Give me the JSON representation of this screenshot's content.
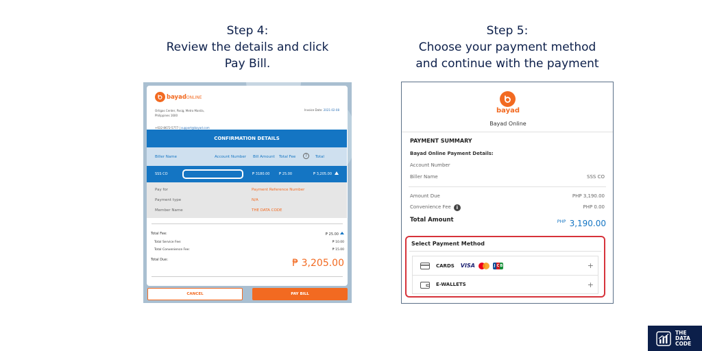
{
  "step4": {
    "line1": "Step 4:",
    "line2": "Review the details and click",
    "line3": "Pay Bill."
  },
  "step5": {
    "line1": "Step 5:",
    "line2": "Choose your payment method",
    "line3": "and continue with the payment"
  },
  "bayad_online_screen": {
    "logo_brand": "bayad",
    "logo_suffix": "ONLINE",
    "address_line1": "Ortigas Center, Pasig, Metro Manila,",
    "address_line2": "Philippines 1600",
    "invoice_label": "Invoice Date:",
    "invoice_date": "2021-02-08",
    "contact_phone": "+632-8672-5777 |",
    "contact_email": "support@bayad.com",
    "confirmation_title": "CONFIRMATION DETAILS",
    "columns": [
      "Biller Name",
      "Account Number",
      "Bill Amount",
      "Total Fee",
      "Total"
    ],
    "selected_row": {
      "biller": "SSS CO",
      "bill_amount": "₱ 3180.00",
      "total_fee": "₱ 25.00",
      "total": "₱ 3,205.00"
    },
    "details": [
      {
        "label": "Pay for",
        "value": "Payment Reference Number"
      },
      {
        "label": "Payment type",
        "value": "N/A"
      },
      {
        "label": "Member Name",
        "value": "THE DATA CODE"
      }
    ],
    "total_fee_label": "Total Fee:",
    "total_fee_value": "₱ 25.00",
    "service_fee_label": "Total Service Fee:",
    "service_fee_value": "₱ 10.00",
    "convenience_fee_label": "Total Convenience Fee:",
    "convenience_fee_value": "₱ 15.00",
    "total_due_label": "Total Due:",
    "total_due_value": "₱ 3,205.00",
    "cancel_label": "CANCEL",
    "pay_bill_label": "PAY BILL"
  },
  "payment_screen": {
    "brand": "bayad",
    "merchant": "Bayad Online",
    "summary_title": "PAYMENT SUMMARY",
    "details_title": "Bayad Online Payment Details:",
    "account_number_label": "Account Number",
    "biller_name_label": "Biller Name",
    "biller_name_value": "SSS CO",
    "amount_due_label": "Amount Due",
    "amount_due_value": "PHP 3,190.00",
    "convenience_fee_label": "Convenience Fee",
    "convenience_fee_value": "PHP 0.00",
    "total_amount_label": "Total Amount",
    "total_currency": "PHP",
    "total_amount_value": "3,190.00",
    "select_method_title": "Select Payment Method",
    "methods": [
      {
        "label": "CARDS",
        "card_brands": [
          "VISA",
          "Mastercard",
          "JCB"
        ]
      },
      {
        "label": "E-WALLETS"
      }
    ]
  },
  "watermark": {
    "line1": "THE",
    "line2": "DATA",
    "line3": "CODE"
  },
  "colors": {
    "navy": "#0c1f4a",
    "bayad_orange": "#f26a21",
    "bayad_blue": "#1475c3",
    "highlight_red": "#d6323a"
  }
}
